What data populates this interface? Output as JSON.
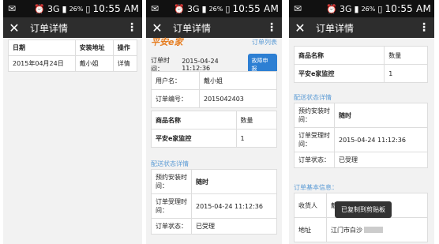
{
  "status": {
    "time": "10:55 AM",
    "battery": "26%",
    "network": "3G"
  },
  "phone1": {
    "title": "订单详情",
    "headers": [
      "日期",
      "安装地址",
      "操作"
    ],
    "row": [
      "2015年04月24日",
      "戴小姐",
      "详情"
    ]
  },
  "phone2": {
    "title": "订单详情",
    "brand": "平安e家",
    "order_link": "订单列表",
    "order_time_label": "订单时间：",
    "order_time": "2015-04-24 11:12:36",
    "fault_button": "故障申报",
    "user_label": "用户名：",
    "user_value": "戴小姐",
    "order_no_label": "订单编号：",
    "order_no_value": "2015042403",
    "product_header": "商品名称",
    "qty_header": "数量",
    "product_name": "平安e家监控",
    "product_qty": "1",
    "delivery_section": "配送状态详情",
    "appt_label": "预约安装时间：",
    "appt_value": "随时",
    "accept_label": "订单受理时间：",
    "accept_value": "2015-04-24 11:12:36",
    "state_label": "订单状态：",
    "state_value": "已受理"
  },
  "phone3": {
    "title": "订单详情",
    "product_header": "商品名称",
    "qty_header": "数量",
    "product_name": "平安e家监控",
    "product_qty": "1",
    "delivery_section": "配送状态详情",
    "appt_label": "预约安装时间：",
    "appt_value": "随时",
    "accept_label": "订单受理时间：",
    "accept_value": "2015-04-24 11:12:36",
    "state_label": "订单状态：",
    "state_value": "已受理",
    "basic_section": "订单基本信息：",
    "receiver_label": "收货人",
    "receiver_value": "戴小姐",
    "address_label": "地址",
    "address_value": "江门市白沙",
    "toast": "已复制到剪贴板"
  }
}
